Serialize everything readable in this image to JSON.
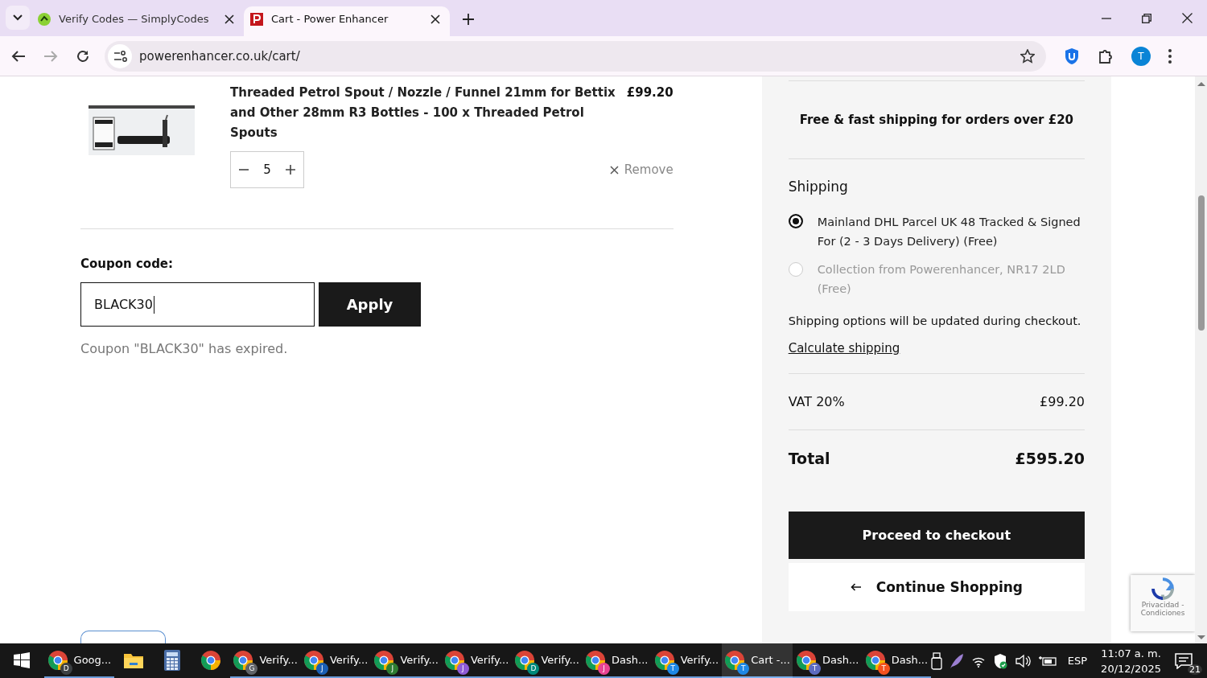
{
  "browser": {
    "tabs": [
      {
        "title": "Verify Codes — SimplyCodes",
        "selected": false
      },
      {
        "title": "Cart - Power Enhancer",
        "selected": true
      }
    ],
    "url": "powerenhancer.co.uk/cart/",
    "profile_initial": "T"
  },
  "cart_item": {
    "title": "Threaded Petrol Spout / Nozzle / Funnel 21mm for Bettix and Other 28mm R3 Bottles - 100 x Threaded Petrol Spouts",
    "price": "£99.20",
    "quantity": "5",
    "remove_label": "Remove"
  },
  "coupon": {
    "label": "Coupon code:",
    "value": "BLACK30",
    "apply_label": "Apply",
    "message": "Coupon \"BLACK30\" has expired."
  },
  "summary": {
    "promo": "Free & fast shipping for orders over £20",
    "shipping_heading": "Shipping",
    "shipping_options": [
      {
        "label": "Mainland DHL Parcel UK 48 Tracked & Signed For (2 - 3 Days Delivery) (Free)",
        "selected": true
      },
      {
        "label": "Collection from Powerenhancer, NR17 2LD (Free)",
        "selected": false
      }
    ],
    "shipping_note": "Shipping options will be updated during checkout.",
    "calculate_link": "Calculate shipping",
    "vat_label": "VAT 20%",
    "vat_value": "£99.20",
    "total_label": "Total",
    "total_value": "£595.20",
    "checkout_label": "Proceed to checkout",
    "continue_label": "Continue Shopping"
  },
  "recaptcha": {
    "text": "Privacidad - Condiciones"
  },
  "taskbar": {
    "items": [
      {
        "kind": "chrome",
        "label": "Goog...",
        "badge": "D",
        "color": "#3c4043",
        "active": false
      },
      {
        "kind": "folder"
      },
      {
        "kind": "calculator"
      },
      {
        "kind": "chrome"
      },
      {
        "kind": "chrome",
        "label": "Verify...",
        "badge": "G",
        "color": "#5f6368",
        "active": false
      },
      {
        "kind": "chrome",
        "label": "Verify...",
        "badge": "J",
        "color": "#1a5fb4",
        "active": false
      },
      {
        "kind": "chrome",
        "label": "Verify...",
        "badge": "J",
        "color": "#2e7d32",
        "active": false
      },
      {
        "kind": "chrome",
        "label": "Verify...",
        "badge": "J",
        "color": "#8e5bd6",
        "active": false
      },
      {
        "kind": "chrome",
        "label": "Verify...",
        "badge": "D",
        "color": "#00897b",
        "active": false
      },
      {
        "kind": "chrome",
        "label": "Dash...",
        "badge": "J",
        "color": "#e84393",
        "active": false
      },
      {
        "kind": "chrome",
        "label": "Verify...",
        "badge": "T",
        "color": "#1e88e5",
        "active": false
      },
      {
        "kind": "chrome",
        "label": "Cart -...",
        "badge": "T",
        "color": "#1e88e5",
        "active": true
      },
      {
        "kind": "chrome",
        "label": "Dash...",
        "badge": "T",
        "color": "#5c6bc0",
        "active": false
      },
      {
        "kind": "chrome",
        "label": "Dash...",
        "badge": "T",
        "color": "#f4511e",
        "active": false
      }
    ],
    "language": "ESP",
    "time": "11:07 a. m.",
    "date": "20/12/2025",
    "notifications": "21"
  }
}
